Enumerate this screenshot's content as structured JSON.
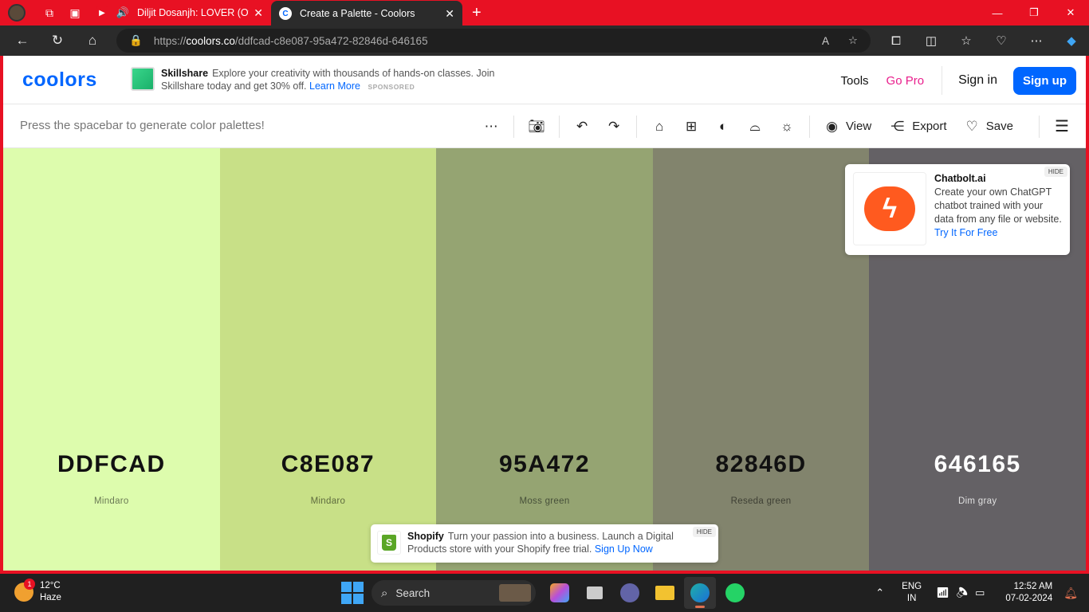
{
  "browser": {
    "tabs": [
      {
        "title": "Diljit Dosanjh: LOVER (Offici",
        "favicon": "youtube-icon",
        "audio": true
      },
      {
        "title": "Create a Palette - Coolors",
        "favicon": "coolors-icon",
        "active": true
      }
    ],
    "url_scheme": "https://",
    "url_host": "coolors.co",
    "url_path": "/ddfcad-c8e087-95a472-82846d-646165"
  },
  "header": {
    "logo": "coolors",
    "ad": {
      "brand": "Skillshare",
      "text": "Explore your creativity with thousands of hands-on classes. Join Skillshare today and get 30% off.",
      "link": "Learn More",
      "sponsored": "SPONSORED"
    },
    "tools": "Tools",
    "gopro": "Go Pro",
    "signin": "Sign in",
    "signup": "Sign up"
  },
  "toolbar": {
    "hint": "Press the spacebar to generate color palettes!",
    "view": "View",
    "export": "Export",
    "save": "Save"
  },
  "palette": [
    {
      "hex": "DDFCAD",
      "name": "Mindaro",
      "color": "#DDFCAD",
      "text_color": "#111111",
      "name_color": "#6b7a55"
    },
    {
      "hex": "C8E087",
      "name": "Mindaro",
      "color": "#C8E087",
      "text_color": "#111111",
      "name_color": "#5e6b3e"
    },
    {
      "hex": "95A472",
      "name": "Moss green",
      "color": "#95A472",
      "text_color": "#111111",
      "name_color": "#47503a"
    },
    {
      "hex": "82846D",
      "name": "Reseda green",
      "color": "#82846D",
      "text_color": "#111111",
      "name_color": "#3e3f34"
    },
    {
      "hex": "646165",
      "name": "Dim gray",
      "color": "#646165",
      "text_color": "#ffffff",
      "name_color": "#e0e0e0"
    }
  ],
  "ad_chatbolt": {
    "title": "Chatbolt.ai",
    "text": "Create your own ChatGPT chatbot trained with your data from any file or website.",
    "link": "Try It For Free",
    "hide": "HIDE"
  },
  "ad_shopify": {
    "brand": "Shopify",
    "text": "Turn your passion into a business. Launch a Digital Products store with your Shopify free trial.",
    "link": "Sign Up Now",
    "hide": "HIDE"
  },
  "taskbar": {
    "weather_temp": "12°C",
    "weather_desc": "Haze",
    "weather_badge": "1",
    "search": "Search",
    "lang1": "ENG",
    "lang2": "IN",
    "time": "12:52 AM",
    "date": "07-02-2024"
  }
}
